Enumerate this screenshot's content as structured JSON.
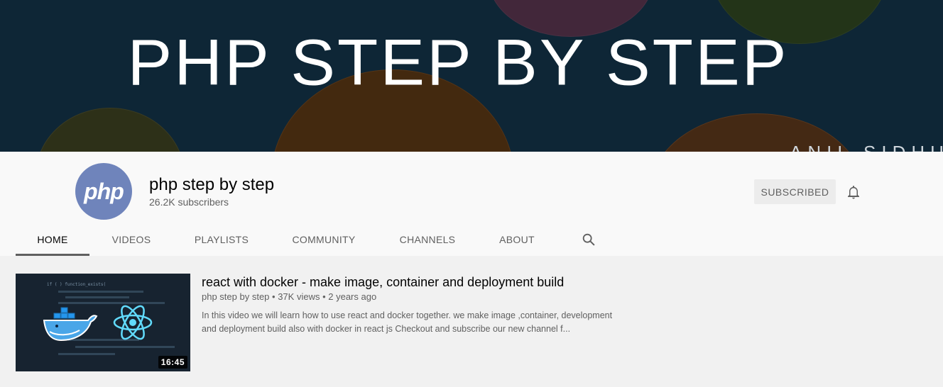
{
  "banner": {
    "title": "PHP STEP BY STEP",
    "signature": "ANIL SIDHU"
  },
  "channel": {
    "avatar_text": "php",
    "name": "php step by step",
    "subscribers": "26.2K subscribers",
    "subscribe_label": "SUBSCRIBED",
    "bell_icon": "bell-icon"
  },
  "tabs": [
    {
      "label": "HOME",
      "active": true
    },
    {
      "label": "VIDEOS"
    },
    {
      "label": "PLAYLISTS"
    },
    {
      "label": "COMMUNITY"
    },
    {
      "label": "CHANNELS"
    },
    {
      "label": "ABOUT"
    }
  ],
  "search_icon": "search-icon",
  "featured_video": {
    "title": "react with docker - make image, container and deployment build",
    "channel": "php step by step",
    "views": "37K views",
    "age": "2 years ago",
    "description_line1": "In this video we will learn how to use react and docker together. we make image ,container, development",
    "description_line2": "and deployment build also with docker in react js Checkout and subscribe our new channel f...",
    "duration": "16:45",
    "thumbnail_icons": [
      "docker-whale-icon",
      "react-atom-icon"
    ]
  },
  "colors": {
    "banner_bg": "#0e2636",
    "avatar_bg": "#6f84bb",
    "page_bg": "#f1f1f1",
    "header_bg": "#f9f9f9"
  }
}
